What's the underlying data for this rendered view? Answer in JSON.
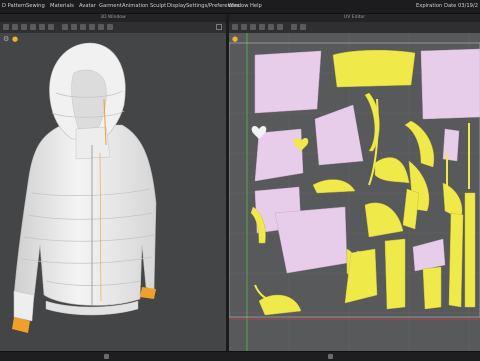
{
  "menubar": {
    "items": [
      "D Pattern",
      "Sewing",
      "Materials",
      "Avatar",
      "Garment",
      "Animation",
      "Sculpt",
      "Display",
      "Settings/Preferences",
      "Window",
      "Help"
    ],
    "expiration": "Expiration Date 03/19/2"
  },
  "windows": {
    "left_title": "3D Window",
    "right_title": "UV Editor"
  },
  "colors": {
    "menu_bg": "#1c1c1e",
    "viewport_3d_bg": "#444547",
    "viewport_2d_bg": "#58595b",
    "pattern_pink": "#e8cdea",
    "pattern_yellow": "#f0e94a",
    "trim_orange": "#f0a02a",
    "garment_white": "#f2f2f2"
  },
  "icons": {
    "viewport_3d": [
      "gear-icon",
      "sun-icon"
    ],
    "viewport_2d": [
      "sun-icon"
    ],
    "uv_editor": [
      "heart-icon",
      "heart-icon"
    ]
  }
}
